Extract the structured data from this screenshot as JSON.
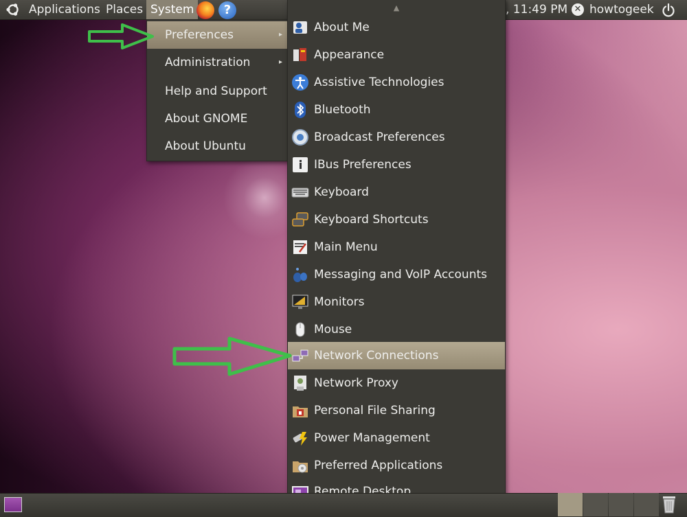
{
  "top_panel": {
    "menus": [
      "Applications",
      "Places",
      "System"
    ],
    "clock": ", 11:49 PM",
    "username": "howtogeek",
    "icons": {
      "logo": "ubuntu-logo-icon",
      "browser": "firefox-icon",
      "help": "help-icon",
      "power": "power-icon",
      "user_status": "user-close-icon"
    }
  },
  "system_menu": {
    "items": [
      {
        "label": "Preferences",
        "submenu": true,
        "highlighted": true
      },
      {
        "label": "Administration",
        "submenu": true
      },
      {
        "label": "Help and Support"
      },
      {
        "label": "About GNOME"
      },
      {
        "label": "About Ubuntu"
      }
    ],
    "submenu_arrow": "▸"
  },
  "preferences_menu": {
    "scroll_up": "▲",
    "scroll_down": "▼",
    "items": [
      {
        "label": "About Me",
        "icon": "about-me-icon"
      },
      {
        "label": "Appearance",
        "icon": "appearance-icon"
      },
      {
        "label": "Assistive Technologies",
        "icon": "accessibility-icon"
      },
      {
        "label": "Bluetooth",
        "icon": "bluetooth-icon"
      },
      {
        "label": "Broadcast Preferences",
        "icon": "broadcast-icon"
      },
      {
        "label": "IBus Preferences",
        "icon": "ibus-icon"
      },
      {
        "label": "Keyboard",
        "icon": "keyboard-icon"
      },
      {
        "label": "Keyboard Shortcuts",
        "icon": "keyboard-shortcuts-icon"
      },
      {
        "label": "Main Menu",
        "icon": "main-menu-icon"
      },
      {
        "label": "Messaging and VoIP Accounts",
        "icon": "messaging-icon"
      },
      {
        "label": "Monitors",
        "icon": "monitors-icon"
      },
      {
        "label": "Mouse",
        "icon": "mouse-icon"
      },
      {
        "label": "Network Connections",
        "icon": "network-connections-icon",
        "highlighted": true
      },
      {
        "label": "Network Proxy",
        "icon": "network-proxy-icon"
      },
      {
        "label": "Personal File Sharing",
        "icon": "file-sharing-icon"
      },
      {
        "label": "Power Management",
        "icon": "power-management-icon"
      },
      {
        "label": "Preferred Applications",
        "icon": "preferred-applications-icon"
      },
      {
        "label": "Remote Desktop",
        "icon": "remote-desktop-icon"
      }
    ]
  },
  "bottom_panel": {
    "icons": {
      "show_desktop": "show-desktop-icon",
      "trash": "trash-icon"
    }
  },
  "annotations": {
    "arrow_color": "#3fbf4a"
  },
  "colors": {
    "panel": "#3a3934",
    "menu_bg": "#3b3a35",
    "menu_highlight": "#a89d86",
    "text": "#eeeeec"
  }
}
